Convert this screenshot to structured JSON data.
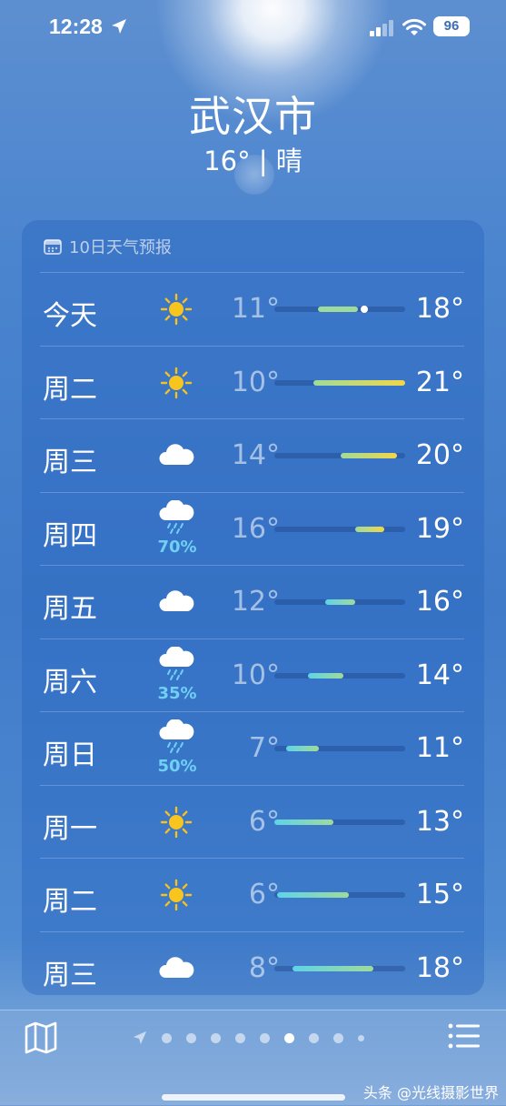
{
  "status_bar": {
    "time": "12:28",
    "battery": "96"
  },
  "header": {
    "city": "武汉市",
    "summary": "16° | 晴"
  },
  "forecast": {
    "title": "10日天气预报",
    "days": [
      {
        "day": "今天",
        "icon": "sun-icon",
        "low": "11°",
        "high": "18°",
        "range_start": 0.33,
        "range_end": 0.64,
        "current": 0.69
      },
      {
        "day": "周二",
        "icon": "sun-icon",
        "low": "10°",
        "high": "21°",
        "range_start": 0.3,
        "range_end": 1.0
      },
      {
        "day": "周三",
        "icon": "cloud-icon",
        "low": "14°",
        "high": "20°",
        "range_start": 0.51,
        "range_end": 0.94
      },
      {
        "day": "周四",
        "icon": "rain-cloud-icon",
        "precip": "70%",
        "low": "16°",
        "high": "19°",
        "range_start": 0.62,
        "range_end": 0.84
      },
      {
        "day": "周五",
        "icon": "cloud-icon",
        "low": "12°",
        "high": "16°",
        "range_start": 0.39,
        "range_end": 0.62
      },
      {
        "day": "周六",
        "icon": "rain-cloud-icon",
        "precip": "35%",
        "low": "10°",
        "high": "14°",
        "range_start": 0.26,
        "range_end": 0.53
      },
      {
        "day": "周日",
        "icon": "rain-cloud-icon",
        "precip": "50%",
        "low": "7°",
        "high": "11°",
        "range_start": 0.09,
        "range_end": 0.34
      },
      {
        "day": "周一",
        "icon": "sun-icon",
        "low": "6°",
        "high": "13°",
        "range_start": 0.0,
        "range_end": 0.45
      },
      {
        "day": "周二",
        "icon": "sun-icon",
        "low": "6°",
        "high": "15°",
        "range_start": 0.02,
        "range_end": 0.57
      },
      {
        "day": "周三",
        "icon": "cloud-icon",
        "low": "8°",
        "high": "18°",
        "range_start": 0.14,
        "range_end": 0.76
      }
    ]
  },
  "bottom_bar": {
    "page_count": 9,
    "active_page": 6
  },
  "watermark": "头条 @光线摄影世界",
  "colors": {
    "cool": "#5fd3e8",
    "mild": "#9fdb9a",
    "warm": "#f2d64a"
  }
}
